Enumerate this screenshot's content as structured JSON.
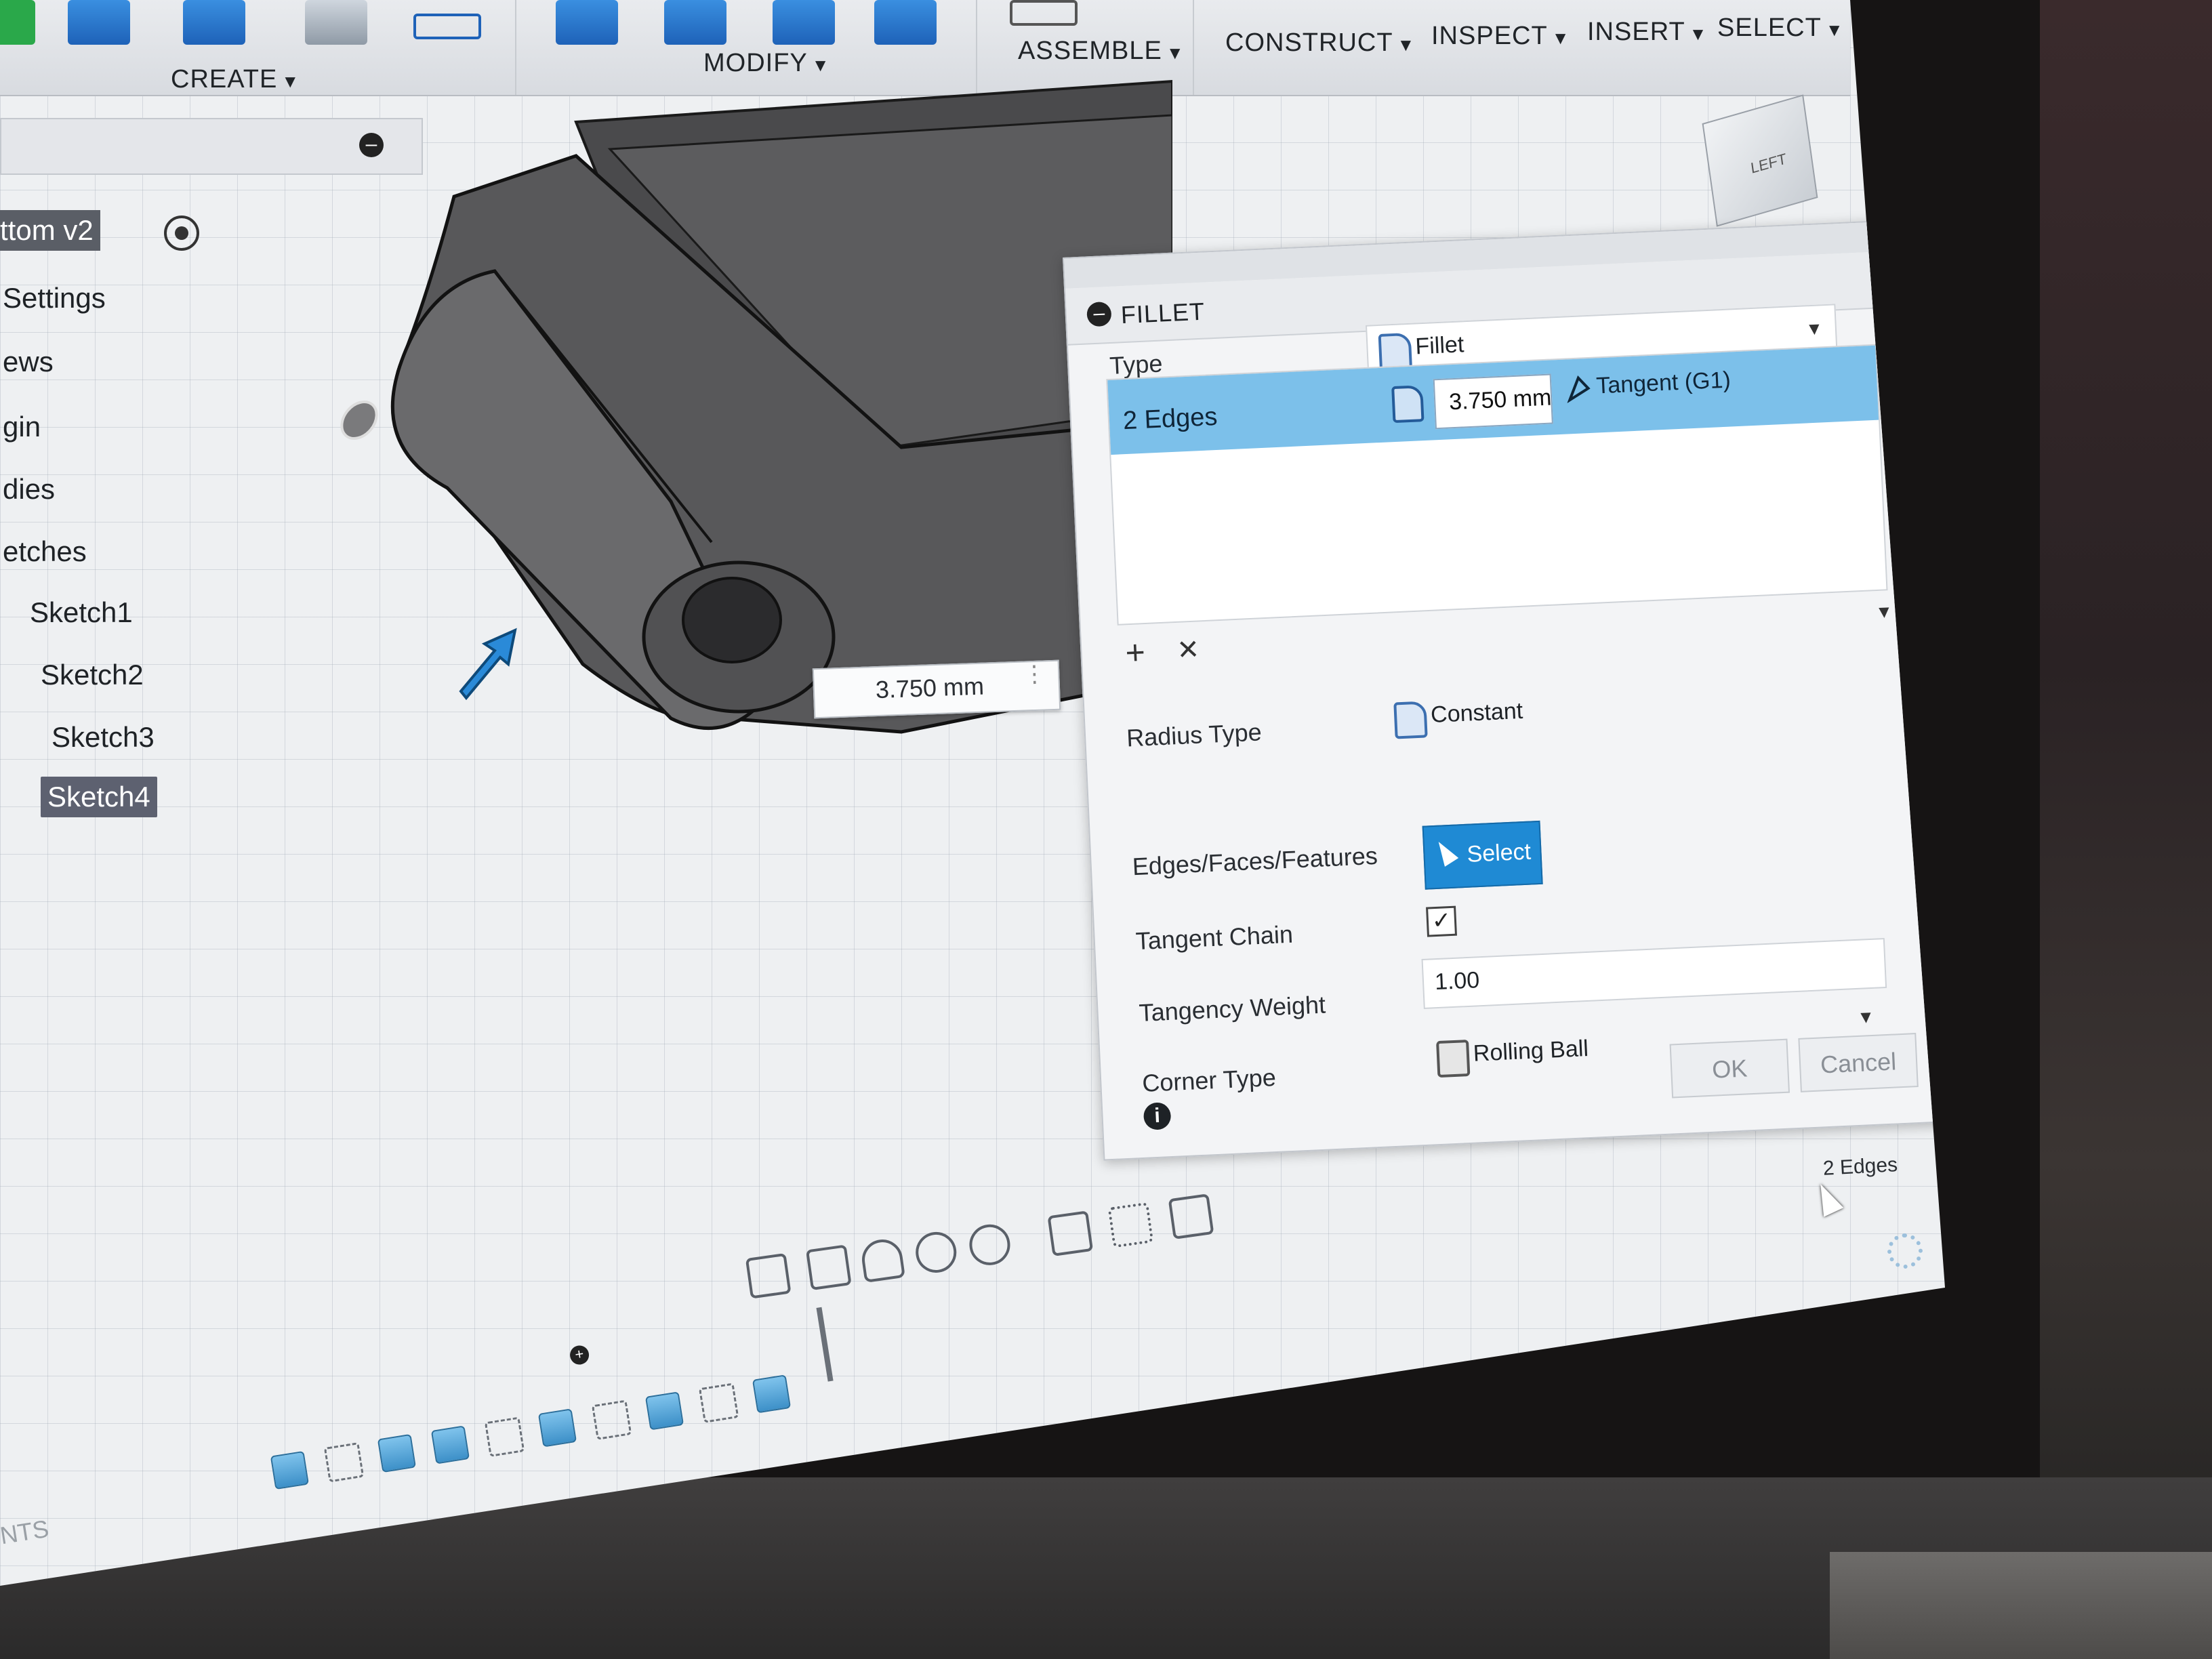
{
  "toolbar": {
    "create": "CREATE",
    "modify": "MODIFY",
    "assemble": "ASSEMBLE",
    "construct": "CONSTRUCT",
    "inspect": "INSPECT",
    "insert": "INSERT",
    "select": "SELECT",
    "caret": "▼"
  },
  "browser": {
    "root": "ttom v2",
    "items": [
      "Settings",
      "ews",
      "gin",
      "dies",
      "etches"
    ],
    "sketches": [
      "Sketch1",
      "Sketch2",
      "Sketch3",
      "Sketch4"
    ],
    "selected": "Sketch4"
  },
  "canvas": {
    "dimension": "3.750 mm",
    "viewcube_face": "LEFT"
  },
  "fillet": {
    "title": "FILLET",
    "type_label": "Type",
    "type_value": "Fillet",
    "edges_label": "2 Edges",
    "radius_value": "3.750 mm",
    "continuity": "Tangent (G1)",
    "add_symbol": "+",
    "remove_symbol": "✕",
    "radius_type_label": "Radius Type",
    "radius_type_value": "Constant",
    "edges_faces_label": "Edges/Faces/Features",
    "select_label": "Select",
    "tangent_chain_label": "Tangent Chain",
    "tangent_chain_checked": true,
    "tangency_weight_label": "Tangency Weight",
    "tangency_weight_value": "1.00",
    "corner_type_label": "Corner Type",
    "corner_type_value": "Rolling Ball",
    "ok_label": "OK",
    "cancel_label": "Cancel",
    "check_mark": "✓",
    "info_symbol": "i"
  },
  "status": {
    "selection_text": "2 Edges"
  },
  "timeline": {
    "label": "NTS"
  },
  "colors": {
    "accent": "#1f8ad4",
    "selection_row": "#7cc0ea",
    "toolbar_icon": "#2a7ad0"
  }
}
